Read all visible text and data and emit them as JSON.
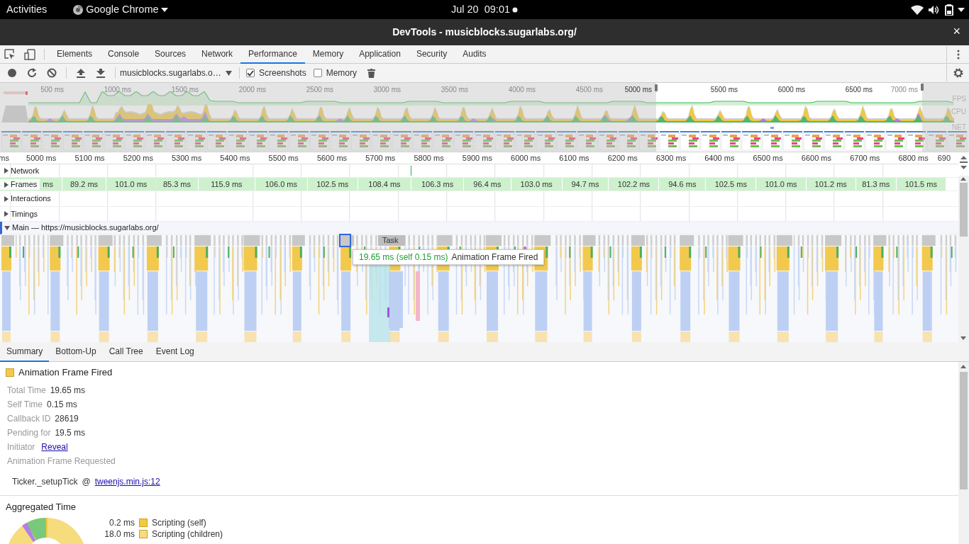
{
  "system_bar": {
    "activities": "Activities",
    "app": "Google Chrome",
    "clock": "Jul 20  09:01"
  },
  "window": {
    "title": "DevTools - musicblocks.sugarlabs.org/",
    "close": "×"
  },
  "panel_tabs": [
    {
      "label": "Elements",
      "selected": false
    },
    {
      "label": "Console",
      "selected": false
    },
    {
      "label": "Sources",
      "selected": false
    },
    {
      "label": "Network",
      "selected": false
    },
    {
      "label": "Performance",
      "selected": true
    },
    {
      "label": "Memory",
      "selected": false
    },
    {
      "label": "Application",
      "selected": false
    },
    {
      "label": "Security",
      "selected": false
    },
    {
      "label": "Audits",
      "selected": false
    }
  ],
  "toolbar": {
    "recording_select": "musicblocks.sugarlabs.o…",
    "options": [
      {
        "label": "Screenshots",
        "checked": true
      },
      {
        "label": "Memory",
        "checked": false
      }
    ]
  },
  "overview": {
    "ticks": [
      "500 ms",
      "1000 ms",
      "1500 ms",
      "2000 ms",
      "2500 ms",
      "3000 ms",
      "3500 ms",
      "4000 ms",
      "4500 ms",
      "5000 ms",
      "5500 ms",
      "6000 ms",
      "6500 ms",
      "7000 ms"
    ],
    "lanes": [
      "FPS",
      "CPU",
      "NET"
    ]
  },
  "timeline": {
    "ticks": [
      "ms",
      "5000 ms",
      "5100 ms",
      "5200 ms",
      "5300 ms",
      "5400 ms",
      "5500 ms",
      "5600 ms",
      "5700 ms",
      "5800 ms",
      "5900 ms",
      "6000 ms",
      "6100 ms",
      "6200 ms",
      "6300 ms",
      "6400 ms",
      "6500 ms",
      "6600 ms",
      "6700 ms",
      "6800 ms",
      "690"
    ],
    "tracks": [
      {
        "label": "Network",
        "expanded": false
      },
      {
        "label": "Frames",
        "expanded": false
      },
      {
        "label": "Interactions",
        "expanded": false
      },
      {
        "label": "Timings",
        "expanded": false
      }
    ],
    "frames": [
      "ms",
      "89.2 ms",
      "101.0 ms",
      "85.3 ms",
      "115.9 ms",
      "106.0 ms",
      "102.5 ms",
      "108.4 ms",
      "106.3 ms",
      "96.4 ms",
      "103.0 ms",
      "94.7 ms",
      "102.2 ms",
      "94.6 ms",
      "102.5 ms",
      "101.0 ms",
      "101.2 ms",
      "81.3 ms",
      "101.5 ms"
    ],
    "main": {
      "label": "Main — https://musicblocks.sugarlabs.org/",
      "expanded": true,
      "task_label": "Task",
      "tooltip": {
        "duration": "19.65 ms (self 0.15 ms)",
        "name": "Animation Frame Fired"
      }
    }
  },
  "detail_tabs": [
    {
      "label": "Summary",
      "selected": true
    },
    {
      "label": "Bottom-Up",
      "selected": false
    },
    {
      "label": "Call Tree",
      "selected": false
    },
    {
      "label": "Event Log",
      "selected": false
    }
  ],
  "summary": {
    "title": "Animation Frame Fired",
    "details": [
      {
        "kind": "text",
        "label": "Total Time",
        "value": "19.65 ms"
      },
      {
        "kind": "text",
        "label": "Self Time",
        "value": "0.15 ms"
      },
      {
        "kind": "text",
        "label": "Callback ID",
        "value": "28619"
      },
      {
        "kind": "text",
        "label": "Pending for",
        "value": "19.5 ms"
      },
      {
        "kind": "link",
        "label": "Initiator",
        "value": "Reveal"
      }
    ],
    "section": "Animation Frame Requested",
    "stack": {
      "function": "Ticker._setupTick",
      "at": "@",
      "link": "tweenjs.min.js:12"
    }
  },
  "aggregated": {
    "title": "Aggregated Time",
    "legend": [
      {
        "value": "0.2 ms",
        "label": "Scripting (self)",
        "color": "#f3ca3e"
      },
      {
        "value": "18.0 ms",
        "label": "Scripting (children)",
        "color": "#f6dc7c"
      }
    ]
  }
}
